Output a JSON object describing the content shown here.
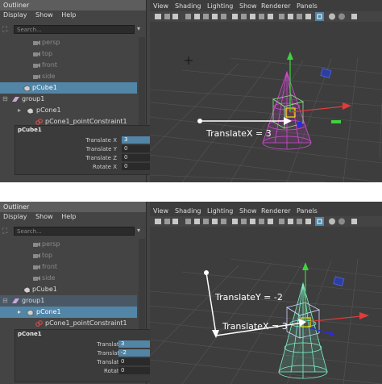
{
  "panels": [
    {
      "outliner": {
        "title": "Outliner",
        "menu": [
          "Display",
          "Show",
          "Help"
        ],
        "search_placeholder": "Search...",
        "items": [
          {
            "label": "persp"
          },
          {
            "label": "top"
          },
          {
            "label": "front"
          },
          {
            "label": "side"
          },
          {
            "label": "pCube1"
          },
          {
            "label": "group1"
          },
          {
            "label": "pCone1"
          },
          {
            "label": "pCone1_pointConstraint1"
          }
        ]
      },
      "attributes": {
        "node": "pCube1",
        "rows": [
          {
            "label": "Translate X",
            "value": "3"
          },
          {
            "label": "Translate Y",
            "value": "0"
          },
          {
            "label": "Translate Z",
            "value": "0"
          },
          {
            "label": "Rotate X",
            "value": "0"
          }
        ]
      },
      "viewport": {
        "menu": [
          "View",
          "Shading",
          "Lighting",
          "Show",
          "Renderer",
          "Panels"
        ],
        "annotations": [
          "TranslateX = 3"
        ]
      }
    },
    {
      "outliner": {
        "title": "Outliner",
        "menu": [
          "Display",
          "Show",
          "Help"
        ],
        "search_placeholder": "Search...",
        "items": [
          {
            "label": "persp"
          },
          {
            "label": "top"
          },
          {
            "label": "front"
          },
          {
            "label": "side"
          },
          {
            "label": "pCube1"
          },
          {
            "label": "group1"
          },
          {
            "label": "pCone1"
          },
          {
            "label": "pCone1_pointConstraint1"
          }
        ]
      },
      "attributes": {
        "node": "pCone1",
        "rows": [
          {
            "label": "Translate X",
            "value": "3"
          },
          {
            "label": "Translate Y",
            "value": "-2"
          },
          {
            "label": "Translate Z",
            "value": "0"
          },
          {
            "label": "Rotate X",
            "value": "0"
          }
        ]
      },
      "viewport": {
        "menu": [
          "View",
          "Shading",
          "Lighting",
          "Show",
          "Renderer",
          "Panels"
        ],
        "annotations": [
          "TranslateY = -2",
          "TranslateX = 3"
        ]
      }
    }
  ]
}
